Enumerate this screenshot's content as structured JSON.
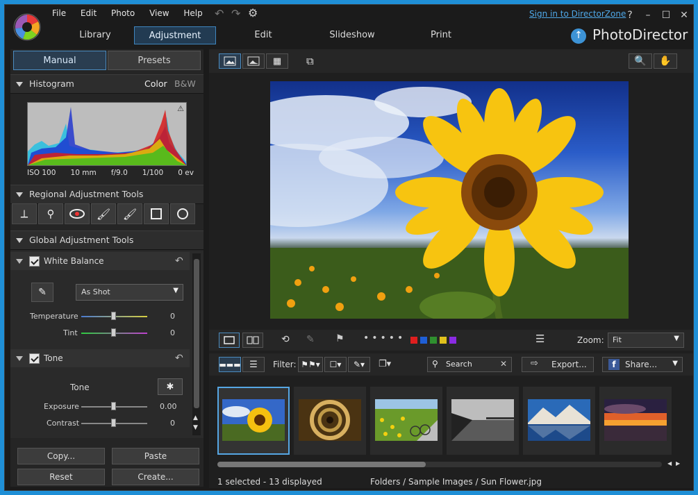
{
  "menu": [
    "File",
    "Edit",
    "Photo",
    "View",
    "Help"
  ],
  "modes": [
    "Library",
    "Adjustment",
    "Edit",
    "Slideshow",
    "Print"
  ],
  "active_mode": "Adjustment",
  "sign_in": "Sign in to DirectorZone",
  "help": "?",
  "app_name": "PhotoDirector",
  "left": {
    "tabs": [
      "Manual",
      "Presets"
    ],
    "histogram": {
      "title": "Histogram",
      "color": "Color",
      "bw": "B&W",
      "exif": [
        "ISO 100",
        "10 mm",
        "f/9.0",
        "1/100",
        "0 ev"
      ]
    },
    "regional": {
      "title": "Regional Adjustment Tools",
      "tools": [
        "crop-icon",
        "spot-removal-icon",
        "red-eye-icon",
        "brush-icon",
        "gradient-brush-icon",
        "square-mask-icon",
        "circle-mask-icon"
      ]
    },
    "global_title": "Global Adjustment Tools",
    "white_balance": {
      "title": "White Balance",
      "preset": "As Shot",
      "temperature_label": "Temperature",
      "temperature_value": "0",
      "tint_label": "Tint",
      "tint_value": "0"
    },
    "tone": {
      "title": "Tone",
      "sub": "Tone",
      "exposure_label": "Exposure",
      "exposure_value": "0.00",
      "contrast_label": "Contrast",
      "contrast_value": "0"
    },
    "buttons": {
      "copy": "Copy...",
      "paste": "Paste",
      "reset": "Reset",
      "create": "Create..."
    }
  },
  "filmstrip_toolbar": {
    "zoom_label": "Zoom:",
    "zoom_value": "Fit",
    "filter_label": "Filter:",
    "search_placeholder": "Search",
    "export": "Export...",
    "share": "Share...",
    "color_labels": [
      "#e01e1e",
      "#1f5fd6",
      "#2f8f2f",
      "#e0c01c",
      "#8a2be2"
    ]
  },
  "thumbnails": [
    "Sun Flower",
    "Spiral",
    "Field Bike",
    "Pier",
    "Mountain Lake",
    "Sunset"
  ],
  "status": {
    "selection": "1 selected - 13 displayed",
    "path": "Folders / Sample Images / Sun Flower.jpg"
  }
}
